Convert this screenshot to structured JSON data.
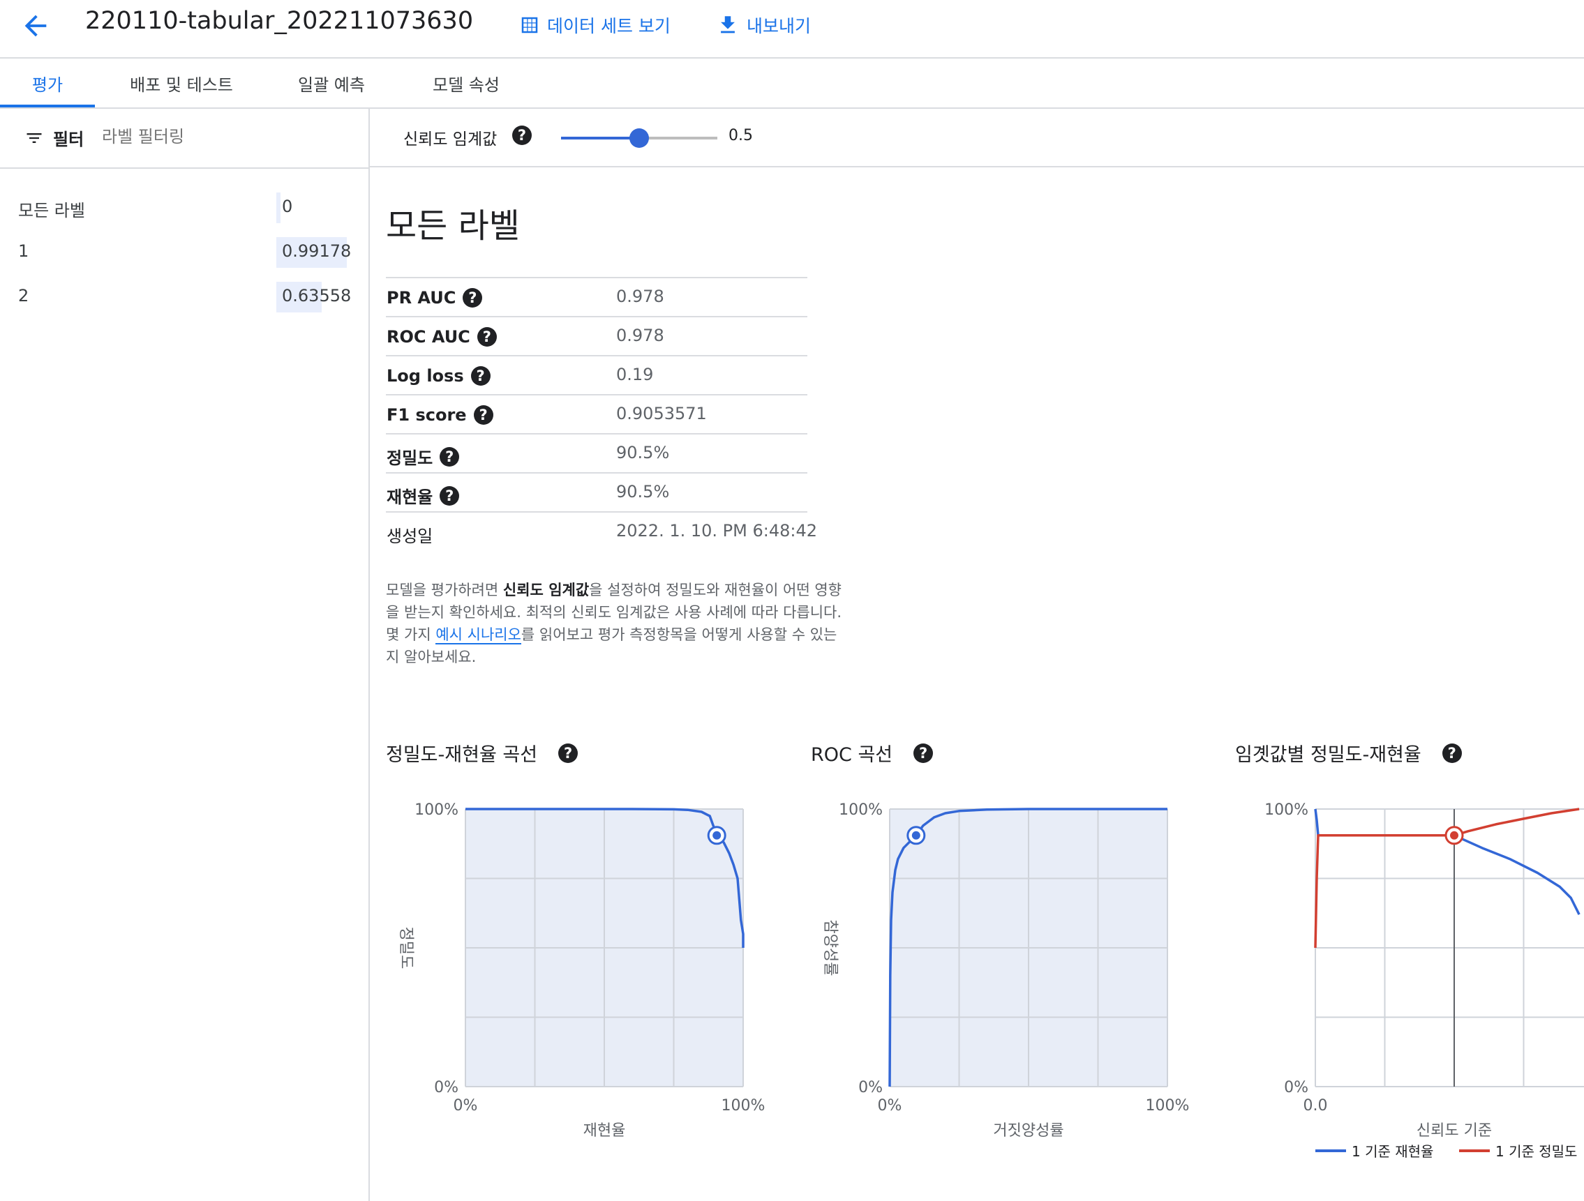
{
  "header": {
    "title": "220110-tabular_202211073630",
    "view_dataset_label": "데이터 세트 보기",
    "export_label": "내보내기"
  },
  "tabs": [
    {
      "label": "평가",
      "active": true
    },
    {
      "label": "배포 및 테스트",
      "active": false
    },
    {
      "label": "일괄 예측",
      "active": false
    },
    {
      "label": "모델 속성",
      "active": false
    }
  ],
  "filter": {
    "label": "필터",
    "placeholder": "라벨 필터링"
  },
  "labels": [
    {
      "name": "모든 라벨",
      "value": "0",
      "fraction": 0
    },
    {
      "name": "1",
      "value": "0.99178",
      "fraction": 0.99178
    },
    {
      "name": "2",
      "value": "0.63558",
      "fraction": 0.63558
    }
  ],
  "threshold": {
    "label": "신뢰도 임계값",
    "value": 0.5,
    "value_text": "0.5"
  },
  "main": {
    "title": "모든 라벨",
    "metrics": [
      {
        "key": "PR AUC",
        "value": "0.978",
        "help": true
      },
      {
        "key": "ROC AUC",
        "value": "0.978",
        "help": true
      },
      {
        "key": "Log loss",
        "value": "0.19",
        "help": true
      },
      {
        "key": "F1 score",
        "value": "0.9053571",
        "help": true
      },
      {
        "key": "정밀도",
        "value": "90.5%",
        "help": true
      },
      {
        "key": "재현율",
        "value": "90.5%",
        "help": true
      },
      {
        "key": "생성일",
        "value": "2022. 1. 10. PM 6:48:42",
        "help": false
      }
    ],
    "description": {
      "part1": "모델을 평가하려면 ",
      "bold": "신뢰도 임계값",
      "part2": "을 설정하여 정밀도와 재현율이 어떤 영향을 받는지 확인하세요. 최적의 신뢰도 임계값은 사용 사례에 따라 다릅니다. 몇 가지 ",
      "link": "예시 시나리오",
      "part3": "를 읽어보고 평가 측정항목을 어떻게 사용할 수 있는지 알아보세요."
    }
  },
  "colors": {
    "accent": "#1a73e8",
    "curve_blue": "#3367d6",
    "curve_red": "#d23f31",
    "plot_fill": "#e8edf7"
  },
  "chart_data": [
    {
      "type": "line",
      "title": "정밀도-재현율 곡선",
      "xlabel": "재현율",
      "ylabel": "정밀도",
      "xlim": [
        0,
        100
      ],
      "ylim": [
        0,
        100
      ],
      "x_ticks": [
        "0%",
        "100%"
      ],
      "y_ticks": [
        "0%",
        "100%"
      ],
      "series": [
        {
          "x": [
            0,
            20,
            40,
            60,
            75,
            80,
            85,
            88,
            90.5,
            93,
            95,
            96.5,
            98,
            99.2,
            100,
            100
          ],
          "y": [
            100,
            100,
            100,
            100,
            99.9,
            99.7,
            99,
            97.5,
            90.5,
            88,
            84,
            80,
            75,
            60,
            55,
            50
          ]
        }
      ],
      "marker": {
        "x": 90.5,
        "y": 90.5
      }
    },
    {
      "type": "line",
      "title": "ROC 곡선",
      "xlabel": "거짓양성률",
      "ylabel": "참양성률",
      "xlim": [
        0,
        100
      ],
      "ylim": [
        0,
        100
      ],
      "x_ticks": [
        "0%",
        "100%"
      ],
      "y_ticks": [
        "0%",
        "100%"
      ],
      "series": [
        {
          "x": [
            0,
            0.2,
            0.5,
            1,
            2,
            3,
            5,
            9.5,
            12,
            16,
            20,
            25,
            35,
            50,
            75,
            100
          ],
          "y": [
            0,
            40,
            60,
            70,
            78,
            82,
            86,
            90.5,
            94,
            97,
            98.5,
            99.3,
            99.8,
            100,
            100,
            100
          ]
        }
      ],
      "marker": {
        "x": 9.5,
        "y": 90.5
      }
    },
    {
      "type": "line",
      "title": "임곗값별 정밀도-재현율",
      "xlabel": "신뢰도 기준",
      "ylabel": "",
      "xlim": [
        0,
        1
      ],
      "ylim": [
        0,
        100
      ],
      "x_ticks": [
        "0.0"
      ],
      "y_ticks": [
        "0%",
        "100%"
      ],
      "threshold_line": 0.5,
      "series": [
        {
          "name": "1 기준 재현율",
          "color": "#3367d6",
          "x": [
            0,
            0.005,
            0.01,
            0.5,
            0.6,
            0.7,
            0.8,
            0.88,
            0.92,
            0.95
          ],
          "y": [
            100,
            96,
            90.5,
            90.5,
            86,
            82,
            77,
            72,
            68,
            62
          ]
        },
        {
          "name": "1 기준 정밀도",
          "color": "#d23f31",
          "x": [
            0,
            0.005,
            0.01,
            0.5,
            0.55,
            0.65,
            0.75,
            0.85,
            0.95
          ],
          "y": [
            50,
            75,
            90.5,
            90.5,
            92,
            94.5,
            96.5,
            98.5,
            100
          ]
        }
      ],
      "marker": {
        "x": 0.5,
        "y": 90.5
      }
    }
  ]
}
